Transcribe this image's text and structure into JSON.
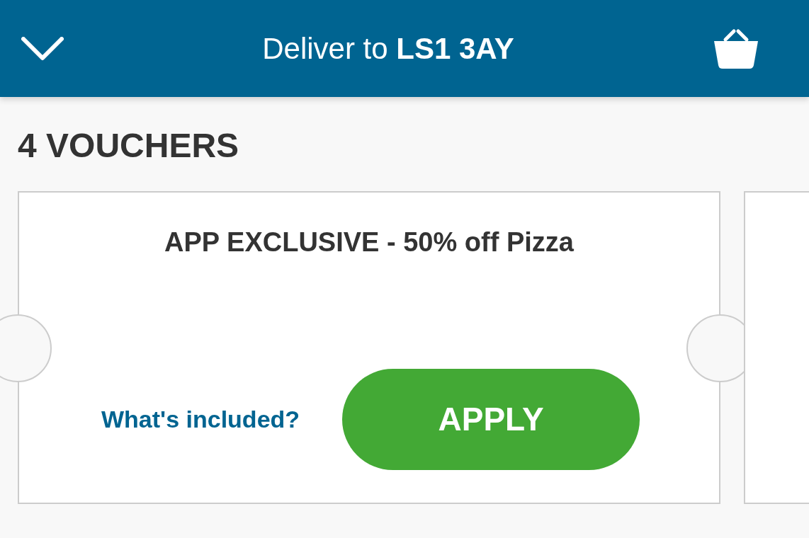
{
  "header": {
    "title": "Deliver to **LS1 3AY**"
  },
  "voucher_count": "4 VOUCHERS",
  "vouchers": [
    {
      "title": "APP EXCLUSIVE - 50% off Pizza",
      "link": "What's included?",
      "button": "APPLY"
    }
  ]
}
